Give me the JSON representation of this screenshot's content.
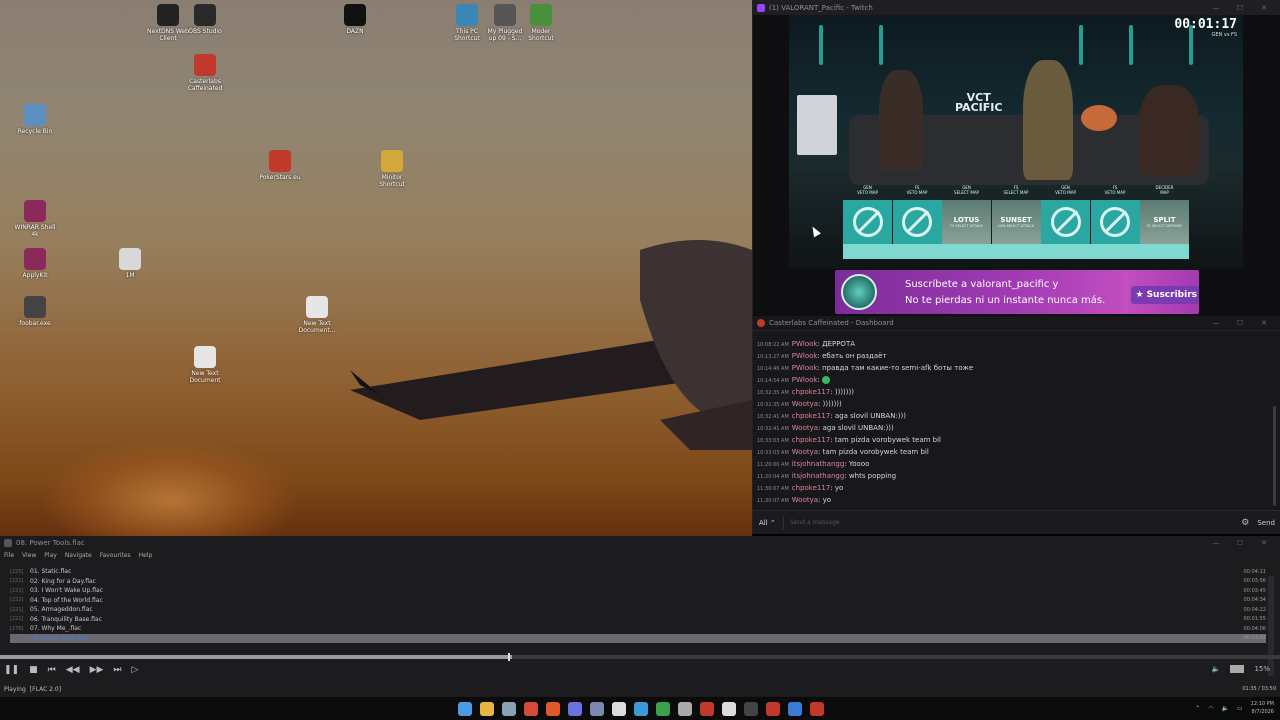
{
  "desktop": {
    "icons": [
      {
        "label": "NextDNS Web\nClient",
        "icon": "webcam-icon",
        "color": "#222"
      },
      {
        "label": "OBS Studio",
        "icon": "obs-icon",
        "color": "#2a2a2a"
      },
      {
        "label": "DAZN",
        "icon": "dazn-icon",
        "color": "#111"
      },
      {
        "label": "This PC\nShortcut",
        "icon": "monitor-icon",
        "color": "#3a86b6"
      },
      {
        "label": "My Plugged\nup 09 - S...",
        "icon": "drive-icon",
        "color": "#555"
      },
      {
        "label": "Moder\nShortcut",
        "icon": "folder-icon",
        "color": "#4a8f3a"
      },
      {
        "label": "Casterlabs\nCaffeinated",
        "icon": "casterlabs-icon",
        "color": "#c0392b"
      },
      {
        "label": "Recycle Bin",
        "icon": "recycle-bin-icon",
        "color": "#5a8fbf"
      },
      {
        "label": "PokerStars.eu",
        "icon": "pokerstars-icon",
        "color": "#c0392b"
      },
      {
        "label": "Minitor\nShortcut",
        "icon": "folder-icon",
        "color": "#d4a83a"
      },
      {
        "label": "WINRAR Shell\n4k",
        "icon": "winrar-icon",
        "color": "#8b2a5a"
      },
      {
        "label": "1M",
        "icon": "file-icon",
        "color": "#d8d8d8"
      },
      {
        "label": "ApplyKit",
        "icon": "winrar-icon",
        "color": "#8b2a5a"
      },
      {
        "label": "New Text\nDocument...",
        "icon": "text-file-icon",
        "color": "#e6e6e6"
      },
      {
        "label": "foobar.exe",
        "icon": "app-icon",
        "color": "#444"
      },
      {
        "label": "New Text\nDocument",
        "icon": "text-file-icon",
        "color": "#e6e6e6"
      }
    ]
  },
  "twitch": {
    "title": "(1) VALORANT_Pacific - Twitch",
    "timer": "00:01:17",
    "match": "GEN vs FS",
    "vct_logo": "VCT\nPACIFIC",
    "veto": [
      {
        "team": "GEN",
        "action": "VETO MAP",
        "type": "ban",
        "map": ""
      },
      {
        "team": "FS",
        "action": "VETO MAP",
        "type": "ban",
        "map": ""
      },
      {
        "team": "GEN",
        "action": "SELECT MAP",
        "type": "pick",
        "map": "LOTUS",
        "sub": "FS SELECT ATTACK"
      },
      {
        "team": "FS",
        "action": "SELECT MAP",
        "type": "pick",
        "map": "SUNSET",
        "sub": "GEN SELECT ATTACK"
      },
      {
        "team": "GEN",
        "action": "VETO MAP",
        "type": "ban",
        "map": ""
      },
      {
        "team": "FS",
        "action": "VETO MAP",
        "type": "ban",
        "map": ""
      },
      {
        "team": "DECIDER",
        "action": "MAP",
        "type": "pick",
        "map": "SPLIT",
        "sub": "FS SELECT DEFENSE"
      }
    ],
    "banner": {
      "line1": "Suscríbete a valorant_pacific y",
      "line2": "No te pierdas ni un instante nunca más.",
      "button": "Suscribirs"
    }
  },
  "chat": {
    "title": "Casterlabs Caffeinated - Dashboard",
    "messages": [
      {
        "ts": "10:08:22 AM",
        "user": "PWlook",
        "text": "ДЕРРОТА"
      },
      {
        "ts": "10:13:27 AM",
        "user": "PWlook",
        "text": "ебать он раздаёт"
      },
      {
        "ts": "10:14:46 AM",
        "user": "PWlook",
        "text": "правда там какие-то semi-afk боты тоже"
      },
      {
        "ts": "10:14:54 AM",
        "user": "PWlook",
        "text": "",
        "emoji": true
      },
      {
        "ts": "10:32:35 AM",
        "user": "chpoke117",
        "text": ")))))))"
      },
      {
        "ts": "10:32:35 AM",
        "user": "Wootya",
        "text": ")))))))"
      },
      {
        "ts": "10:32:41 AM",
        "user": "chpoke117",
        "text": "aga slovil UNBAN:)))"
      },
      {
        "ts": "10:32:41 AM",
        "user": "Wootya",
        "text": "aga slovil UNBAN:)))"
      },
      {
        "ts": "10:33:03 AM",
        "user": "chpoke117",
        "text": "tam pizda vorobywek team bil"
      },
      {
        "ts": "10:33:03 AM",
        "user": "Wootya",
        "text": "tam pizda vorobywek team bil"
      },
      {
        "ts": "11:20:00 AM",
        "user": "itsjohnathangg",
        "text": "Yoooo"
      },
      {
        "ts": "11:20:04 AM",
        "user": "itsjohnathangg",
        "text": "whts popping"
      },
      {
        "ts": "11:30:07 AM",
        "user": "chpoke117",
        "text": "yo"
      },
      {
        "ts": "11:30:07 AM",
        "user": "Wootya",
        "text": "yo"
      }
    ],
    "filter": "All",
    "placeholder": "Send a message",
    "send": "Send"
  },
  "player": {
    "title": "08. Power Tools.flac",
    "menu": [
      "File",
      "View",
      "Play",
      "Navigate",
      "Favourites",
      "Help"
    ],
    "tracks": [
      {
        "num": "[225]",
        "name": "01. Static.flac",
        "dur": "00:04:11"
      },
      {
        "num": "[221]",
        "name": "02. King for a Day.flac",
        "dur": "00:03:56"
      },
      {
        "num": "[221]",
        "name": "03. I Won't Wake Up.flac",
        "dur": "00:03:45"
      },
      {
        "num": "[222]",
        "name": "04. Top of the World.flac",
        "dur": "00:04:34"
      },
      {
        "num": "[221]",
        "name": "05. Armageddon.flac",
        "dur": "00:04:22"
      },
      {
        "num": "[221]",
        "name": "06. Tranquility Base.flac",
        "dur": "00:01:55"
      },
      {
        "num": "[276]",
        "name": "07. Why Me_.flac",
        "dur": "00:04:06"
      },
      {
        "num": "[227]",
        "name": "08. Power Tools.flac",
        "dur": "00:03:59",
        "active": true
      }
    ],
    "volume": "15%",
    "status_left": "Playing",
    "status_format": "[FLAC 2.0]",
    "status_time": "01:35 / 03:59"
  },
  "taskbar": {
    "apps": [
      {
        "icon": "windows-start-icon",
        "color": "#4a9be0"
      },
      {
        "icon": "file-explorer-icon",
        "color": "#e8b640"
      },
      {
        "icon": "settings-icon",
        "color": "#8aa0b4"
      },
      {
        "icon": "chrome-icon",
        "color": "#d64a3a"
      },
      {
        "icon": "brave-icon",
        "color": "#e05a2a"
      },
      {
        "icon": "discord-icon",
        "color": "#6a74e0"
      },
      {
        "icon": "app-icon",
        "color": "#7a8ab0"
      },
      {
        "icon": "epic-icon",
        "color": "#ddd"
      },
      {
        "icon": "telegram-icon",
        "color": "#3a9ad8"
      },
      {
        "icon": "green-app-icon",
        "color": "#3aa04a"
      },
      {
        "icon": "steam-icon",
        "color": "#aaa"
      },
      {
        "icon": "casterlabs-icon",
        "color": "#c0392b"
      },
      {
        "icon": "notepad-icon",
        "color": "#ddd"
      },
      {
        "icon": "terminal-icon",
        "color": "#444"
      },
      {
        "icon": "red-app-icon",
        "color": "#c0392b"
      },
      {
        "icon": "blue-app-icon",
        "color": "#3a7ad8"
      },
      {
        "icon": "twitch-red-icon",
        "color": "#c0392b"
      }
    ],
    "time": "12:10 PM",
    "date": "8/7/2026"
  }
}
